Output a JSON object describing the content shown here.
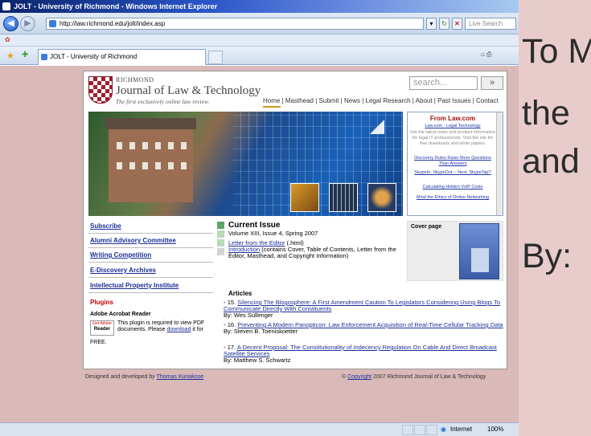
{
  "window": {
    "title": "JOLT - University of Richmond - Windows Internet Explorer",
    "controls": [
      "_",
      "▫",
      "×"
    ]
  },
  "toolbar": {
    "address": "http://law.richmond.edu/jolt/index.asp",
    "search_placeholder": "Live Search",
    "tab_label": "JOLT - University of Richmond",
    "tools_label": "Tools"
  },
  "status": {
    "zone": "Internet",
    "zoom": "100%"
  },
  "slide": {
    "line1": "To M",
    "line2": "the",
    "line3": "and",
    "line4": "By:"
  },
  "page": {
    "university": "RICHMOND",
    "journal_title": "Journal of Law & Technology",
    "tagline": "The first exclusively online law review.",
    "search_placeholder": "search...",
    "search_button": "»",
    "nav": [
      "Home",
      "Masthead",
      "Submit",
      "News",
      "Legal Research",
      "About",
      "Past Issues",
      "Contact"
    ],
    "lawcom": {
      "heading": "From Law.com",
      "subheading": "Law.com - Legal Technology",
      "blurb": "Get the latest news and product information for legal IT professionals. Visit the site for free downloads and white papers.",
      "links": [
        "Discovery Rules Raise More Questions Than Answers",
        "SkypeIn, SkypeOut -- Next, SkypeTap?",
        "Calculating Hidden VoIP Costs",
        "Mind the Ethics of Online Networking"
      ]
    },
    "sidebar": {
      "links": [
        "Subscribe",
        "Alumni Advisory Committee",
        "Writing Competition",
        "E-Discovery Archives",
        "Intellectual Property Institute"
      ],
      "plugins_heading": "Plugins",
      "acrobat_title": "Adobe Acrobat Reader",
      "acrobat_logo_top": "Get Adobe",
      "acrobat_logo_bottom": "Reader",
      "acrobat_text": "This plugin is required to view PDF documents. Please",
      "download_link": "download",
      "acrobat_tail": "it for",
      "free": "FREE."
    },
    "current_issue": {
      "heading": "Current Issue",
      "volume": "Volume XIII, Issue 4, Spring 2007",
      "letter_link": "Letter from the Editor",
      "letter_suffix": "(.html)",
      "intro_link": "Introduction",
      "intro_text": "(contains Cover, Table of Contents, Letter from the Editor, Masthead, and Copyright Information)",
      "cover_label": "Cover page",
      "colors": [
        "#5aa66a",
        "#b9dbb6",
        "#d3d3d3"
      ]
    },
    "articles": {
      "heading": "Articles",
      "items": [
        {
          "num": "15.",
          "title": "Silencing The Blogosphere: A First Amendment Caution To Legislators Considering Using Blogs To Communicate Directly With Constituents",
          "author": "By: Wes Sullenger"
        },
        {
          "num": "16.",
          "title": "Preventing A Modern Panopticon: Law Enforcement Acquisition of Real-Time Cellular Tracking Data",
          "author": "By: Steven B. Toeniskoetter"
        },
        {
          "num": "17.",
          "title": "A Decent Proposal: The Constitutionality of Indecency Regulation On Cable And Direct Broadcast Satellite Services",
          "author": "By: Matthew S. Schwartz"
        }
      ]
    },
    "footer": {
      "left_prefix": "Designed and developed by",
      "left_link": "Thomas Kuriakose",
      "right_prefix": "©",
      "right_link": "Copyright",
      "right_suffix": "2007 Richmond Journal of Law & Technology"
    }
  }
}
